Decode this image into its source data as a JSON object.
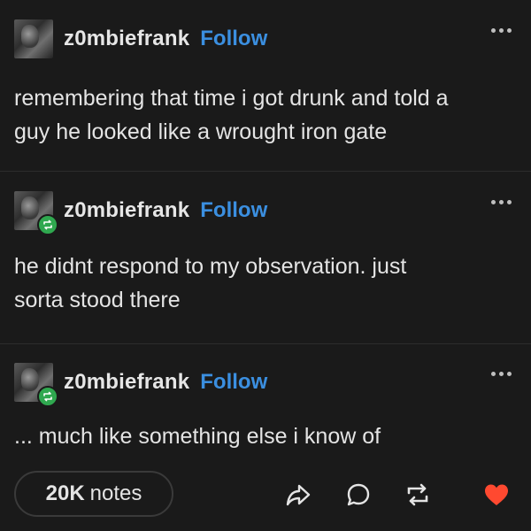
{
  "posts": [
    {
      "username": "z0mbiefrank",
      "follow_label": "Follow",
      "reblog": false,
      "lines": [
        "remembering that time i got drunk and told a",
        "guy he looked like a wrought iron gate"
      ]
    },
    {
      "username": "z0mbiefrank",
      "follow_label": "Follow",
      "reblog": true,
      "lines": [
        "he didnt respond to my observation. just",
        "sorta stood there"
      ]
    },
    {
      "username": "z0mbiefrank",
      "follow_label": "Follow",
      "reblog": true,
      "lines": [
        "... much like something else i know of"
      ]
    }
  ],
  "footer": {
    "notes_count": "20K",
    "notes_label": "notes",
    "actions": [
      "share-icon",
      "comment-icon",
      "reblog-icon",
      "like-icon"
    ]
  },
  "colors": {
    "background": "#1a1a1a",
    "follow": "#3b8fe0",
    "reblog_badge": "#2fa84f",
    "like": "#ff4930"
  }
}
